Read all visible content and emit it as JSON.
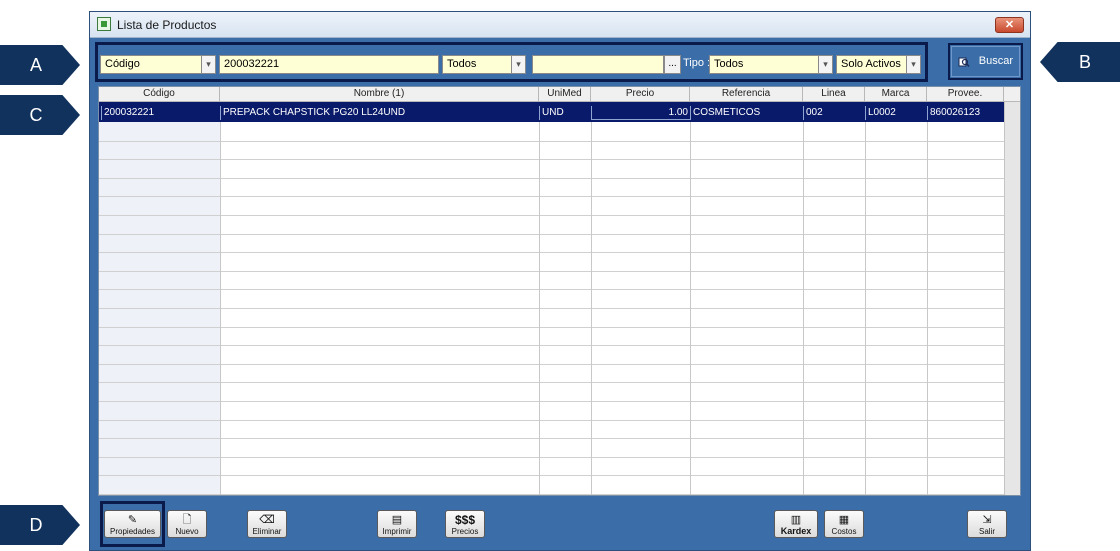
{
  "window": {
    "title": "Lista de Productos",
    "close_glyph": "✕"
  },
  "search": {
    "field_select": "Código",
    "code_value": "200032221",
    "scope_select": "Todos",
    "text_value": "",
    "dots_label": "...",
    "tipo_label": "Tipo :",
    "tipo_select": "Todos",
    "status_select": "Solo Activos",
    "buscar_label": "Buscar"
  },
  "grid": {
    "columns": [
      "Código",
      "Nombre (1)",
      "UniMed",
      "Precio",
      "Referencia",
      "Linea",
      "Marca",
      "Provee."
    ],
    "rows": [
      {
        "codigo": "200032221",
        "nombre": "PREPACK CHAPSTICK PG20 LL24UND",
        "unimed": "UND",
        "precio": "1.00",
        "referencia": "COSMETICOS",
        "linea": "002",
        "marca": "L0002",
        "provee": "860026123"
      }
    ]
  },
  "toolbar": {
    "propiedades": "Propiedades",
    "nuevo": "Nuevo",
    "eliminar": "Eliminar",
    "imprimir": "Imprimir",
    "precios_icon": "$$$",
    "precios": "Precios",
    "kardex": "Kardex",
    "costos": "Costos",
    "salir": "Salir"
  },
  "callouts": {
    "a": "A",
    "b": "B",
    "c": "C",
    "d": "D"
  },
  "colors": {
    "window_blue": "#3b6ea8",
    "selection_navy": "#0a1a6a",
    "field_yellow": "#ffffd6",
    "callout_navy": "#12325e"
  }
}
